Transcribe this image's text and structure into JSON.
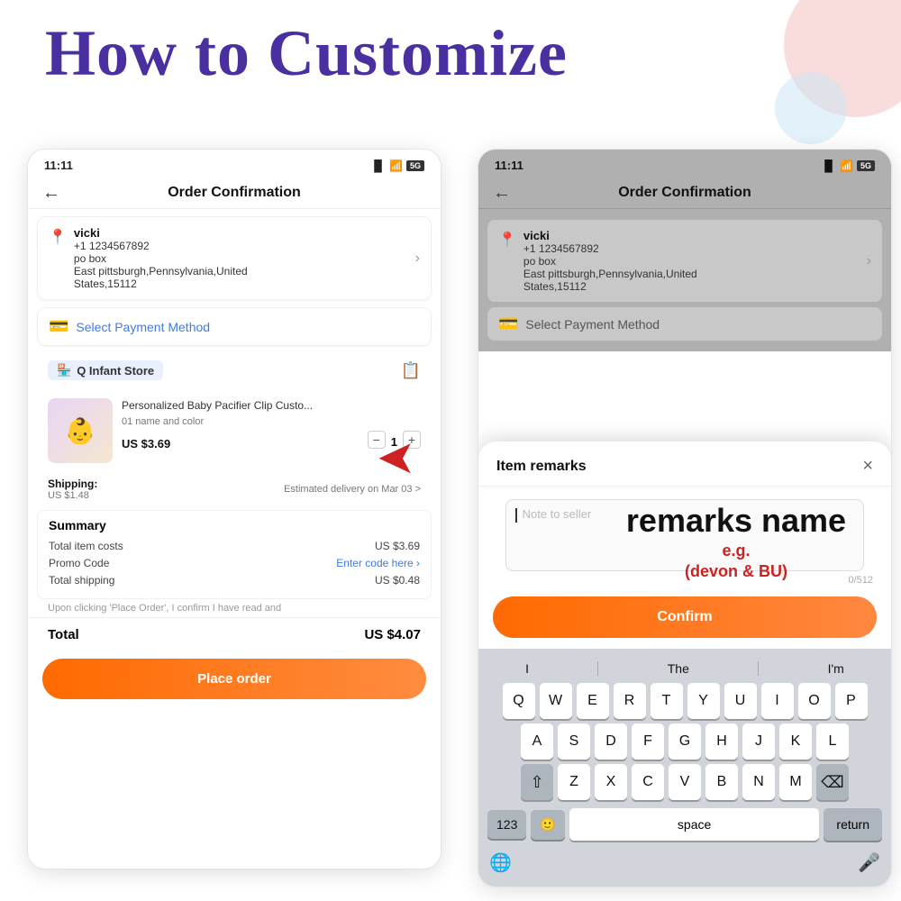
{
  "page": {
    "title": "How to Customize",
    "bg_circle_1": "#f5c5c5",
    "bg_circle_2": "#c8e6f5"
  },
  "left_phone": {
    "status_time": "11:11",
    "header_title": "Order Confirmation",
    "address": {
      "name": "vicki",
      "phone": "+1 1234567892",
      "line1": "po box",
      "line2": "East pittsburgh,Pennsylvania,United",
      "line3": "States,15112"
    },
    "payment_label": "Select Payment Method",
    "store_name": "Q Infant Store",
    "product": {
      "title": "Personalized Baby Pacifier Clip Custo...",
      "variant": "01 name and color",
      "price": "US $3.69",
      "quantity": "1"
    },
    "shipping_label": "Shipping:",
    "shipping_cost": "US $1.48",
    "delivery_text": "Estimated delivery on Mar 03 >",
    "summary_title": "Summary",
    "summary_items": [
      {
        "label": "Total item costs",
        "value": "US $3.69"
      },
      {
        "label": "Promo Code",
        "value": "Enter code here >"
      },
      {
        "label": "Total shipping",
        "value": "US $0.48"
      }
    ],
    "disclaimer": "Upon clicking 'Place Order', I confirm I have read and",
    "total_label": "Total",
    "total_amount": "US $4.07",
    "place_order_btn": "Place order"
  },
  "right_phone": {
    "status_time": "11:11",
    "header_title": "Order Confirmation",
    "address": {
      "name": "vicki",
      "phone": "+1 1234567892",
      "line1": "po box",
      "line2": "East pittsburgh,Pennsylvania,United",
      "line3": "States,15112"
    },
    "payment_label": "Select Payment Method"
  },
  "remarks_modal": {
    "title": "Item remarks",
    "close_btn": "×",
    "placeholder": "Note to seller",
    "counter": "0/512",
    "confirm_btn": "Confirm",
    "annotation_name": "remarks name",
    "annotation_eg": "e.g.\n(devon & BU)"
  },
  "keyboard": {
    "suggestions": [
      "I",
      "The",
      "I'm"
    ],
    "rows": [
      [
        "Q",
        "W",
        "E",
        "R",
        "T",
        "Y",
        "U",
        "I",
        "O",
        "P"
      ],
      [
        "A",
        "S",
        "D",
        "F",
        "G",
        "H",
        "J",
        "K",
        "L"
      ],
      [
        "Z",
        "X",
        "C",
        "V",
        "B",
        "N",
        "M"
      ]
    ],
    "bottom": {
      "num_label": "123",
      "emoji": "🙂",
      "space_label": "space",
      "return_label": "return"
    }
  },
  "arrow": "←"
}
